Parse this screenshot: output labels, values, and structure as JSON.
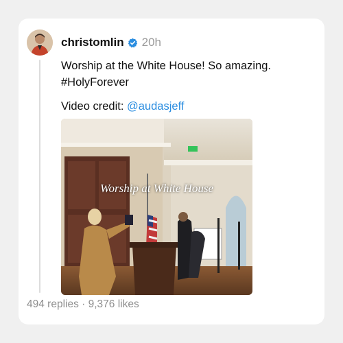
{
  "post": {
    "username": "christomlin",
    "time": "20h",
    "text_line1": "Worship at the White House! So amazing.",
    "text_line2": "#HolyForever",
    "credit_label": "Video credit:",
    "credit_mention": "@audasjeff",
    "video_caption": "Worship at White House",
    "stats": {
      "replies": "494 replies",
      "separator": "·",
      "likes": "9,376 likes"
    }
  },
  "colors": {
    "verified": "#2a8de0",
    "mention": "#2a8de0",
    "muted": "#8e8e8e"
  },
  "icons": {
    "verified": "verified-badge-icon"
  }
}
